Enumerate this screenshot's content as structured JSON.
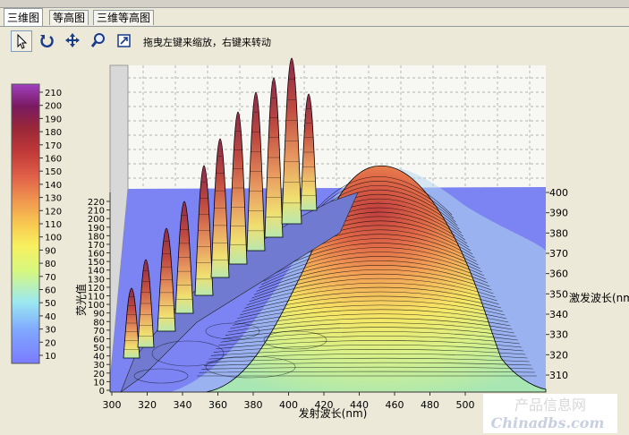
{
  "tabs": [
    {
      "label": "三维图",
      "active": true
    },
    {
      "label": "等高图",
      "active": false
    },
    {
      "label": "三维等高图",
      "active": false
    }
  ],
  "toolbar": {
    "hint": "拖曳左键来缩放，右键来转动",
    "tools": [
      "pointer-icon",
      "rotate-icon",
      "move-icon",
      "zoom-icon",
      "export-icon"
    ]
  },
  "colorbar": {
    "ticks": [
      "210",
      "200",
      "190",
      "180",
      "170",
      "160",
      "150",
      "140",
      "130",
      "120",
      "110",
      "100",
      "90",
      "80",
      "70",
      "60",
      "50",
      "40",
      "30",
      "20",
      "10"
    ]
  },
  "z_axis": {
    "label": "荧光值",
    "ticks": [
      "220",
      "210",
      "200",
      "190",
      "180",
      "170",
      "160",
      "150",
      "140",
      "130",
      "120",
      "110",
      "100",
      "90",
      "80",
      "70",
      "60",
      "50",
      "40",
      "30",
      "20",
      "10",
      "0"
    ]
  },
  "x_axis": {
    "label": "发射波长(nm)",
    "ticks": [
      "300",
      "320",
      "340",
      "360",
      "380",
      "400",
      "420",
      "440",
      "460",
      "480",
      "500"
    ]
  },
  "y_axis": {
    "label": "激发波长(nm)",
    "ticks": [
      "400",
      "390",
      "380",
      "370",
      "360",
      "350",
      "340",
      "330",
      "320",
      "310"
    ]
  },
  "watermark": {
    "line1": "产品信息网",
    "line2": "Chinadbs.com"
  },
  "colors": {
    "base_plane": "#7b84f2",
    "colormap": [
      "#7b7bff",
      "#80a8ff",
      "#9be8f0",
      "#d6f880",
      "#f8f060",
      "#f8c850",
      "#f09850",
      "#e06048",
      "#c03838",
      "#9a2838",
      "#7a1a60",
      "#a040c0"
    ]
  }
}
